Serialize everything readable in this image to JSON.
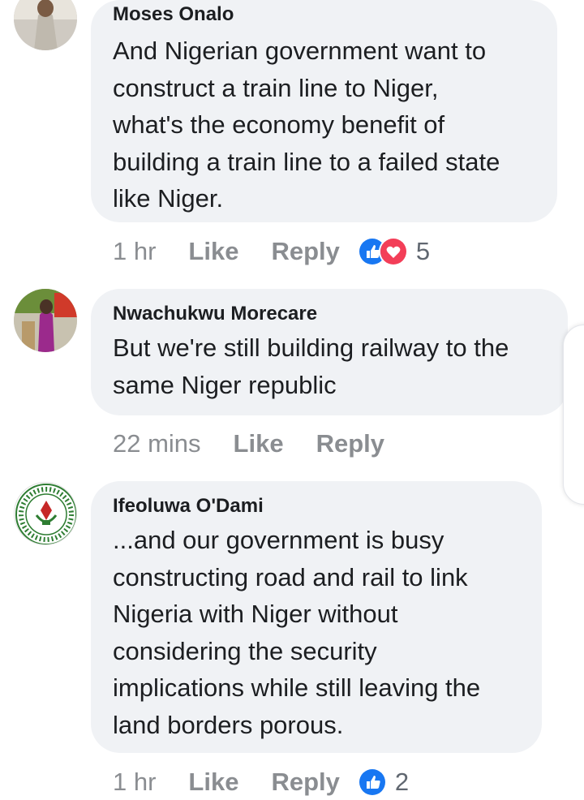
{
  "comments": [
    {
      "author": "Moses Onalo",
      "text_lines": [
        "And Nigerian government want to",
        "construct a train line to Niger,",
        "what's the economy benefit of",
        "building a train line to a failed state",
        "like Niger."
      ],
      "time": "1 hr",
      "like_label": "Like",
      "reply_label": "Reply",
      "reaction_icons": [
        "like-icon",
        "love-icon"
      ],
      "reaction_count": "5"
    },
    {
      "author": "Nwachukwu Morecare",
      "text_lines": [
        "But we're still building railway to the",
        "same Niger republic"
      ],
      "time": "22 mins",
      "like_label": "Like",
      "reply_label": "Reply"
    },
    {
      "author": "Ifeoluwa O'Dami",
      "text_lines": [
        "...and our government is busy",
        "constructing road and rail to link",
        "Nigeria with Niger without",
        "considering the security",
        "implications while still leaving the",
        "land borders porous."
      ],
      "time": "1 hr",
      "like_label": "Like",
      "reply_label": "Reply",
      "reaction_icons": [
        "like-icon"
      ],
      "reaction_count": "2"
    }
  ],
  "colors": {
    "bubble_bg": "#f0f2f5",
    "meta_text": "#8a8d91",
    "like_blue": "#1877f2",
    "love_red": "#f33e58"
  }
}
